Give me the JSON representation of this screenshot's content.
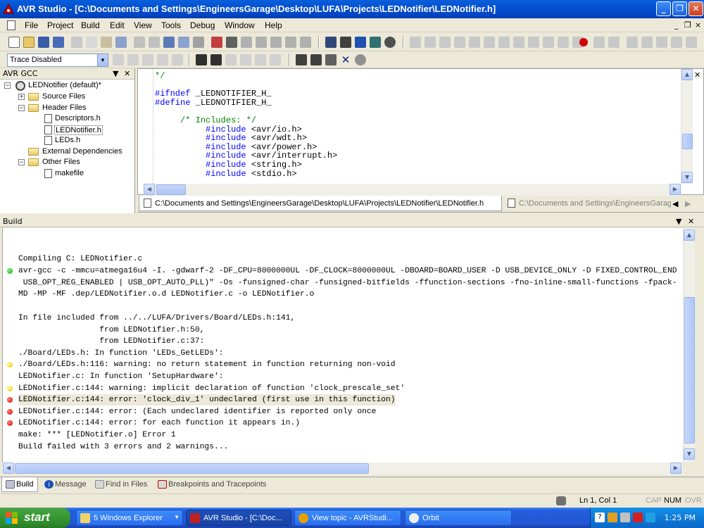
{
  "window": {
    "title": "AVR Studio - [C:\\Documents and Settings\\EngineersGarage\\Desktop\\LUFA\\Projects\\LEDNotifier\\LEDNotifier.h]",
    "minimize": "_",
    "maximize": "❐",
    "close": "✕"
  },
  "menu": {
    "items": [
      "File",
      "Project",
      "Build",
      "Edit",
      "View",
      "Tools",
      "Debug",
      "Window",
      "Help"
    ],
    "mdi_minimize": "_",
    "mdi_restore": "❐",
    "mdi_close": "×"
  },
  "trace": {
    "value": "Trace Disabled",
    "arrow": "▼"
  },
  "project_panel": {
    "title": "AVR GCC",
    "pin": "▼",
    "close": "✕",
    "tree": {
      "project": "LEDNotifier (default)*",
      "source_files": "Source Files",
      "header_files": "Header Files",
      "descriptors": "Descriptors.h",
      "lednotifier": "LEDNotifier.h",
      "leds": "LEDs.h",
      "external": "External Dependencies",
      "other": "Other Files",
      "makefile": "makefile",
      "expanded": "−",
      "collapsed": "+"
    }
  },
  "editor": {
    "lines": {
      "l0": "*/",
      "l1_kw": "#ifndef",
      "l1_rest": " _LEDNOTIFIER_H_",
      "l2_kw": "#define",
      "l2_rest": " _LEDNOTIFIER_H_",
      "l3": "/* Includes: */",
      "l4_kw": "#include",
      "l4_rest": " <avr/io.h>",
      "l5_kw": "#include",
      "l5_rest": " <avr/wdt.h>",
      "l6_kw": "#include",
      "l6_rest": " <avr/power.h>",
      "l7_kw": "#include",
      "l7_rest": " <avr/interrupt.h>",
      "l8_kw": "#include",
      "l8_rest": " <string.h>",
      "l9_kw": "#include",
      "l9_rest": " <stdio.h>"
    },
    "scroll_up": "▲",
    "scroll_down": "▼",
    "scroll_left": "◀",
    "scroll_right": "▶"
  },
  "doc_tabs": {
    "active": "C:\\Documents and Settings\\EngineersGarage\\Desktop\\LUFA\\Projects\\LEDNotifier\\LEDNotifier.h",
    "inactive": "C:\\Documents and Settings\\EngineersGarage\\Desktop\\LUFA\\Projects\\LEDNotifier\\LEDNotifier.c",
    "prev": "◀",
    "next": "▶",
    "close": "✕"
  },
  "build_panel": {
    "title": "Build",
    "pin": "▼",
    "close": "✕",
    "lines": [
      {
        "text": "Compiling C: LEDNotifier.c",
        "marker": "none"
      },
      {
        "text": "avr-gcc -c -mmcu=atmega16u4 -I. -gdwarf-2 -DF_CPU=8000000UL -DF_CLOCK=8000000UL -DBOARD=BOARD_USER -D USB_DEVICE_ONLY -D FIXED_CONTROL_END",
        "marker": "green"
      },
      {
        "text": " USB_OPT_REG_ENABLED | USB_OPT_AUTO_PLL)\" -Os -funsigned-char -funsigned-bitfields -ffunction-sections -fno-inline-small-functions -fpack-",
        "marker": "none"
      },
      {
        "text": "MD -MP -MF .dep/LEDNotifier.o.d LEDNotifier.c -o LEDNotifier.o",
        "marker": "none"
      },
      {
        "text": "In file included from ../../LUFA/Drivers/Board/LEDs.h:141,",
        "marker": "none"
      },
      {
        "text": "                 from LEDNotifier.h:50,",
        "marker": "none"
      },
      {
        "text": "                 from LEDNotifier.c:37:",
        "marker": "none"
      },
      {
        "text": "./Board/LEDs.h: In function 'LEDs_GetLEDs':",
        "marker": "none"
      },
      {
        "text": "./Board/LEDs.h:116: warning: no return statement in function returning non-void",
        "marker": "yellow"
      },
      {
        "text": "LEDNotifier.c: In function 'SetupHardware':",
        "marker": "none"
      },
      {
        "text": "LEDNotifier.c:144: warning: implicit declaration of function 'clock_prescale_set'",
        "marker": "yellow"
      },
      {
        "text": "LEDNotifier.c:144: error: 'clock_div_1' undeclared (first use in this function)",
        "marker": "red"
      },
      {
        "text": "LEDNotifier.c:144: error: (Each undeclared identifier is reported only once",
        "marker": "red"
      },
      {
        "text": "LEDNotifier.c:144: error: for each function it appears in.)",
        "marker": "red"
      },
      {
        "text": "make: *** [LEDNotifier.o] Error 1",
        "marker": "none"
      },
      {
        "text": "Build failed with 3 errors and 2 warnings...",
        "marker": "none"
      }
    ]
  },
  "bottom_tabs": [
    "Build",
    "Message",
    "Find in Files",
    "Breakpoints and Tracepoints"
  ],
  "status": {
    "position": "Ln 1, Col 1",
    "cap": "CAP",
    "num": "NUM",
    "ovr": "OVR"
  },
  "taskbar": {
    "start": "start",
    "tasks": [
      "5 Windows Explorer",
      "AVR Studio - [C:\\Doc...",
      "View topic - AVRStudi...",
      "Orbit"
    ],
    "clock": "1:25 PM",
    "tasks_arrow": "▼"
  },
  "colors": {
    "keyword": "#0000ff",
    "comment": "#008000",
    "titlebar": "#0350d1"
  }
}
